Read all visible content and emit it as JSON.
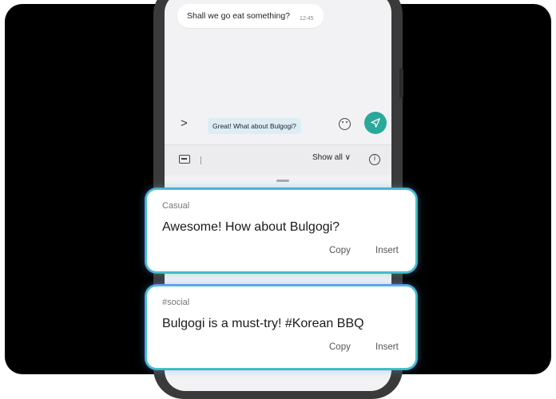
{
  "chat": {
    "incoming_message": "Shall we go eat something?",
    "incoming_time": "12:45",
    "input_text": "Great! What about Bulgogi?"
  },
  "toolbar": {
    "show_all_label": "Show all ∨"
  },
  "suggestions": [
    {
      "tone": "Casual",
      "text": "Awesome! How about Bulgogi?",
      "copy_label": "Copy",
      "insert_label": "Insert"
    },
    {
      "tone": "#social",
      "text": "Bulgogi is a must-try! #Korean BBQ",
      "copy_label": "Copy",
      "insert_label": "Insert"
    }
  ],
  "colors": {
    "send_button": "#2aa89a",
    "card_border": "#3ec6c0",
    "frame_background": "#000000"
  },
  "icons": [
    "chevron-right-icon",
    "emoji-icon",
    "send-icon",
    "keyboard-icon",
    "info-icon"
  ]
}
